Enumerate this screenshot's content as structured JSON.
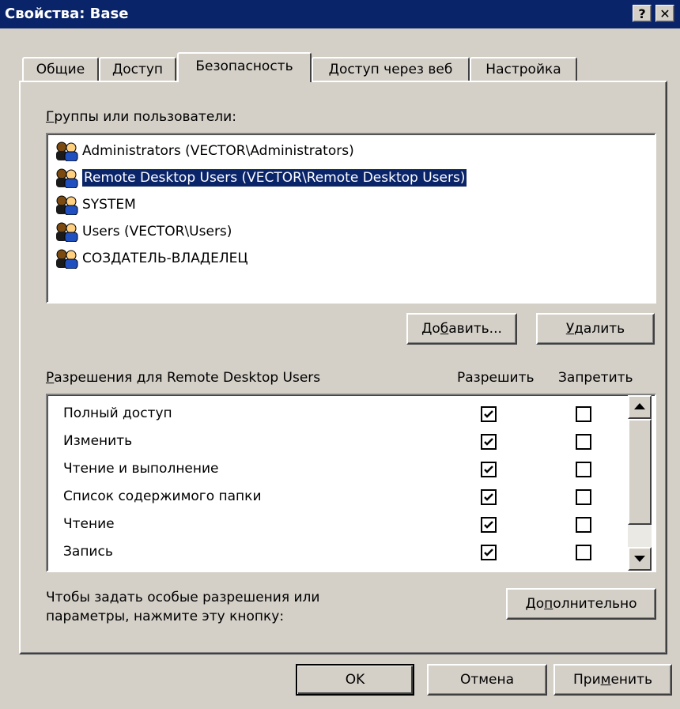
{
  "window": {
    "title": "Свойства: Base",
    "help_glyph": "?",
    "close_glyph": "✕"
  },
  "tabs": [
    {
      "label": "Общие"
    },
    {
      "label": "Доступ"
    },
    {
      "label": "Безопасность",
      "active": true
    },
    {
      "label": "Доступ через веб"
    },
    {
      "label": "Настройка"
    }
  ],
  "security": {
    "groups_label_ul": "Г",
    "groups_label_rest": "руппы или пользователи:",
    "users": [
      {
        "name": "Administrators (VECTOR\\Administrators)",
        "icon": "user-group-icon"
      },
      {
        "name": "Remote Desktop Users (VECTOR\\Remote Desktop Users)",
        "icon": "user-group-icon",
        "selected": true
      },
      {
        "name": "SYSTEM",
        "icon": "user-group-icon"
      },
      {
        "name": "Users (VECTOR\\Users)",
        "icon": "user-group-icon"
      },
      {
        "name": "СОЗДАТЕЛЬ-ВЛАДЕЛЕЦ",
        "icon": "user-group-icon"
      }
    ],
    "add_button": {
      "pre": "До",
      "ul": "б",
      "post": "авить..."
    },
    "remove_button": {
      "ul": "У",
      "post": "далить"
    },
    "permissions_label_ul": "Р",
    "permissions_label_rest": "азрешения для Remote Desktop Users",
    "allow_header": "Разрешить",
    "deny_header": "Запретить",
    "permissions": [
      {
        "name": "Полный доступ",
        "allow": true,
        "deny": false
      },
      {
        "name": "Изменить",
        "allow": true,
        "deny": false
      },
      {
        "name": "Чтение и выполнение",
        "allow": true,
        "deny": false
      },
      {
        "name": "Список содержимого папки",
        "allow": true,
        "deny": false
      },
      {
        "name": "Чтение",
        "allow": true,
        "deny": false
      },
      {
        "name": "Запись",
        "allow": true,
        "deny": false
      }
    ],
    "advanced_hint_line1": "Чтобы задать особые разрешения или",
    "advanced_hint_line2": "параметры, нажмите эту кнопку:",
    "advanced_button": {
      "pre": "До",
      "ul": "п",
      "post": "олнительно"
    }
  },
  "footer": {
    "ok_label": "OK",
    "cancel_label": "Отмена",
    "apply_button": {
      "pre": "При",
      "ul": "м",
      "post": "енить"
    }
  },
  "colors": {
    "titlebar": "#0a246a",
    "face": "#d4d0c8",
    "selection": "#0a246a"
  }
}
